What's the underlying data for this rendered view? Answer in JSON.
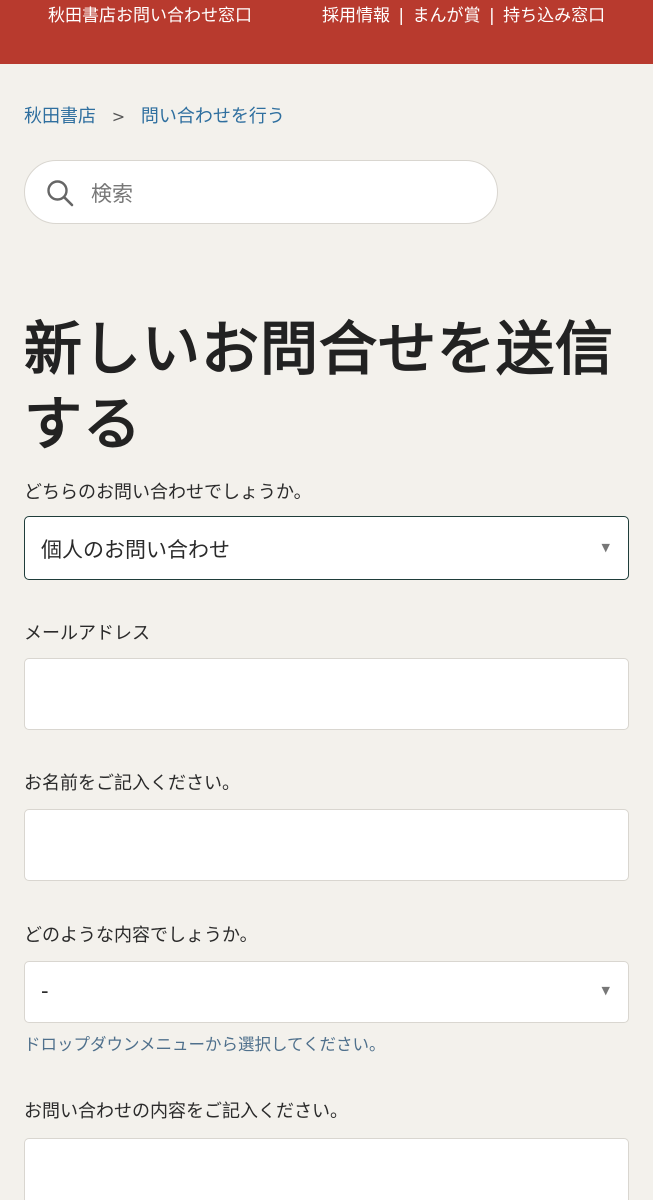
{
  "header": {
    "site_title": "秋田書店お問い合わせ窓口",
    "links": [
      "採用情報",
      "まんが賞",
      "持ち込み窓口"
    ],
    "separator": "|"
  },
  "breadcrumb": {
    "items": [
      "秋田書店",
      "問い合わせを行う"
    ],
    "separator": ">"
  },
  "search": {
    "placeholder": "検索",
    "value": ""
  },
  "page": {
    "title": "新しいお問合せを送信する"
  },
  "form": {
    "inquiry_type": {
      "label": "どちらのお問い合わせでしょうか。",
      "selected": "個人のお問い合わせ"
    },
    "email": {
      "label": "メールアドレス",
      "value": ""
    },
    "name": {
      "label": "お名前をご記入ください。",
      "value": ""
    },
    "topic": {
      "label": "どのような内容でしょうか。",
      "selected": "-",
      "hint": "ドロップダウンメニューから選択してください。"
    },
    "message": {
      "label": "お問い合わせの内容をご記入ください。",
      "value": ""
    }
  },
  "icons": {
    "search": "search-icon",
    "dropdown": "caret-down-icon"
  },
  "colors": {
    "header_bg": "#b83a2e",
    "link": "#2f6f9f",
    "page_bg": "#f3f1ec",
    "focused_border": "#1f3d3a"
  }
}
